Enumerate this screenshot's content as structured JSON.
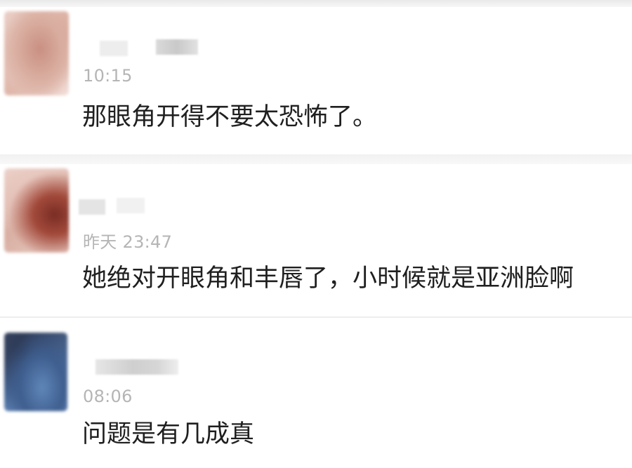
{
  "comments": [
    {
      "time": "10:15",
      "text": "那眼角开得不要太恐怖了。"
    },
    {
      "time": "昨天 23:47",
      "text": "她绝对开眼角和丰唇了，小时候就是亚洲脸啊"
    },
    {
      "time": "08:06",
      "text": "问题是有几成真"
    }
  ]
}
